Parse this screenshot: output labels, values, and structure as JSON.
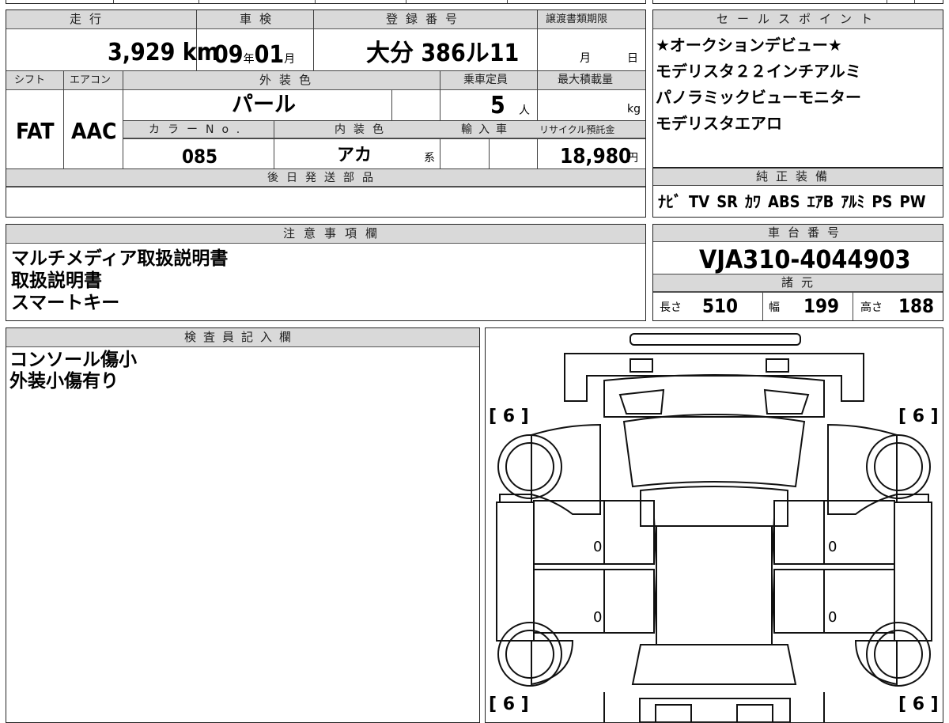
{
  "header": {
    "mileage_label": "走行",
    "inspection_label": "車検",
    "registration_label": "登録番号",
    "transfer_deadline_label": "譲渡書類期限",
    "shift_label": "シフト",
    "aircon_label": "エアコン",
    "exterior_color_label": "外装色",
    "capacity_label": "乗車定員",
    "max_load_label": "最大積載量",
    "color_no_label": "カラーNo.",
    "interior_color_label": "内装色",
    "import_label": "輸入車",
    "recycle_label": "リサイクル預託金",
    "later_parts_label": "後日発送部品"
  },
  "vehicle": {
    "mileage": "3,929",
    "mileage_unit": "km",
    "inspection_year": "09",
    "year_unit": "年",
    "inspection_month": "01",
    "month_unit": "月",
    "registration_number": "大分 386ル11",
    "deadline_month_unit": "月",
    "deadline_day_unit": "日",
    "shift": "FAT",
    "aircon": "AAC",
    "exterior_color": "パール",
    "capacity": "5",
    "capacity_unit": "人",
    "max_load_unit": "kg",
    "color_no": "085",
    "interior_color": "アカ",
    "interior_suffix": "系",
    "recycle_fee": "18,980",
    "recycle_unit": "円"
  },
  "sales_points": {
    "title": "セールスポイント",
    "items": [
      "★オークションデビュー★",
      "モデリスタ２２インチアルミ",
      "パノラミックビューモニター",
      "モデリスタエアロ"
    ]
  },
  "equipment": {
    "title": "純正装備",
    "items": [
      "ﾅﾋﾞ",
      "TV",
      "SR",
      "ｶﾜ",
      "ABS",
      "ｴｱB",
      "ｱﾙﾐ",
      "PS",
      "PW"
    ]
  },
  "notes": {
    "title": "注意事項欄",
    "lines": [
      "マルチメディア取扱説明書",
      "取扱説明書",
      "スマートキー"
    ]
  },
  "chassis": {
    "title": "車台番号",
    "number": "VJA310-4044903"
  },
  "specs": {
    "title": "諸元",
    "length_label": "長さ",
    "length": "510",
    "width_label": "幅",
    "width": "199",
    "height_label": "高さ",
    "height": "188"
  },
  "inspector": {
    "title": "検査員記入欄",
    "lines": [
      "コンソール傷小",
      "外装小傷有り"
    ]
  },
  "diagram": {
    "tire_front_left": "[ 6 ]",
    "tire_front_right": "[ 6 ]",
    "tire_rear_left": "[ 6 ]",
    "tire_rear_right": "[ 6 ]",
    "door_marks": [
      "0",
      "0",
      "0",
      "0"
    ]
  }
}
